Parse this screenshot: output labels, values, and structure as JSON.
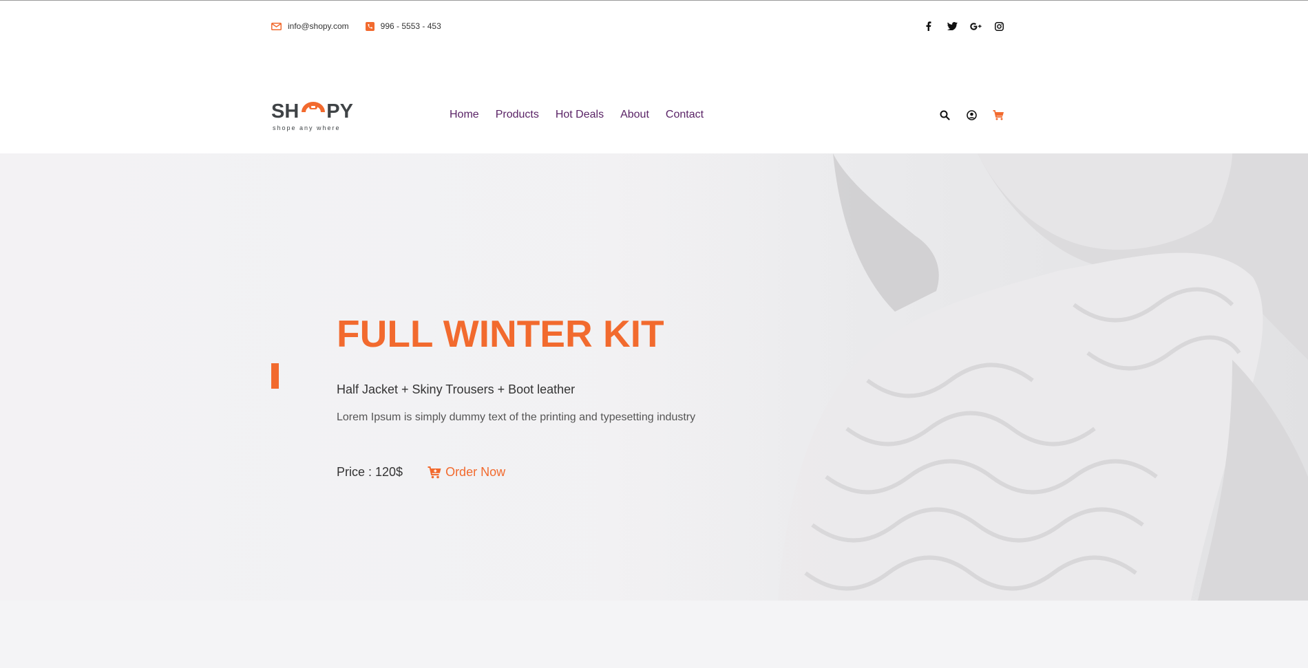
{
  "topbar": {
    "email": "info@shopy.com",
    "phone": "996 - 5553 - 453",
    "email_icon": "envelope-icon",
    "phone_icon": "phone-icon",
    "social": [
      "facebook-icon",
      "twitter-icon",
      "google-plus-icon",
      "instagram-icon"
    ]
  },
  "logo": {
    "text_left": "SH",
    "text_right": "PY",
    "tagline": "shope any where"
  },
  "nav": {
    "items": [
      "Home",
      "Products",
      "Hot Deals",
      "About",
      "Contact"
    ],
    "icons": [
      "search-icon",
      "user-icon",
      "cart-icon"
    ]
  },
  "hero": {
    "title": "FULL WINTER KIT",
    "subtitle": "Half Jacket + Skiny Trousers + Boot leather",
    "description": "Lorem Ipsum is simply dummy text of the printing and typesetting industry",
    "price": "Price : 120$",
    "order_label": "Order Now"
  },
  "colors": {
    "accent": "#f26a2e",
    "nav_text": "#5a2366",
    "logo": "#3f4346"
  }
}
